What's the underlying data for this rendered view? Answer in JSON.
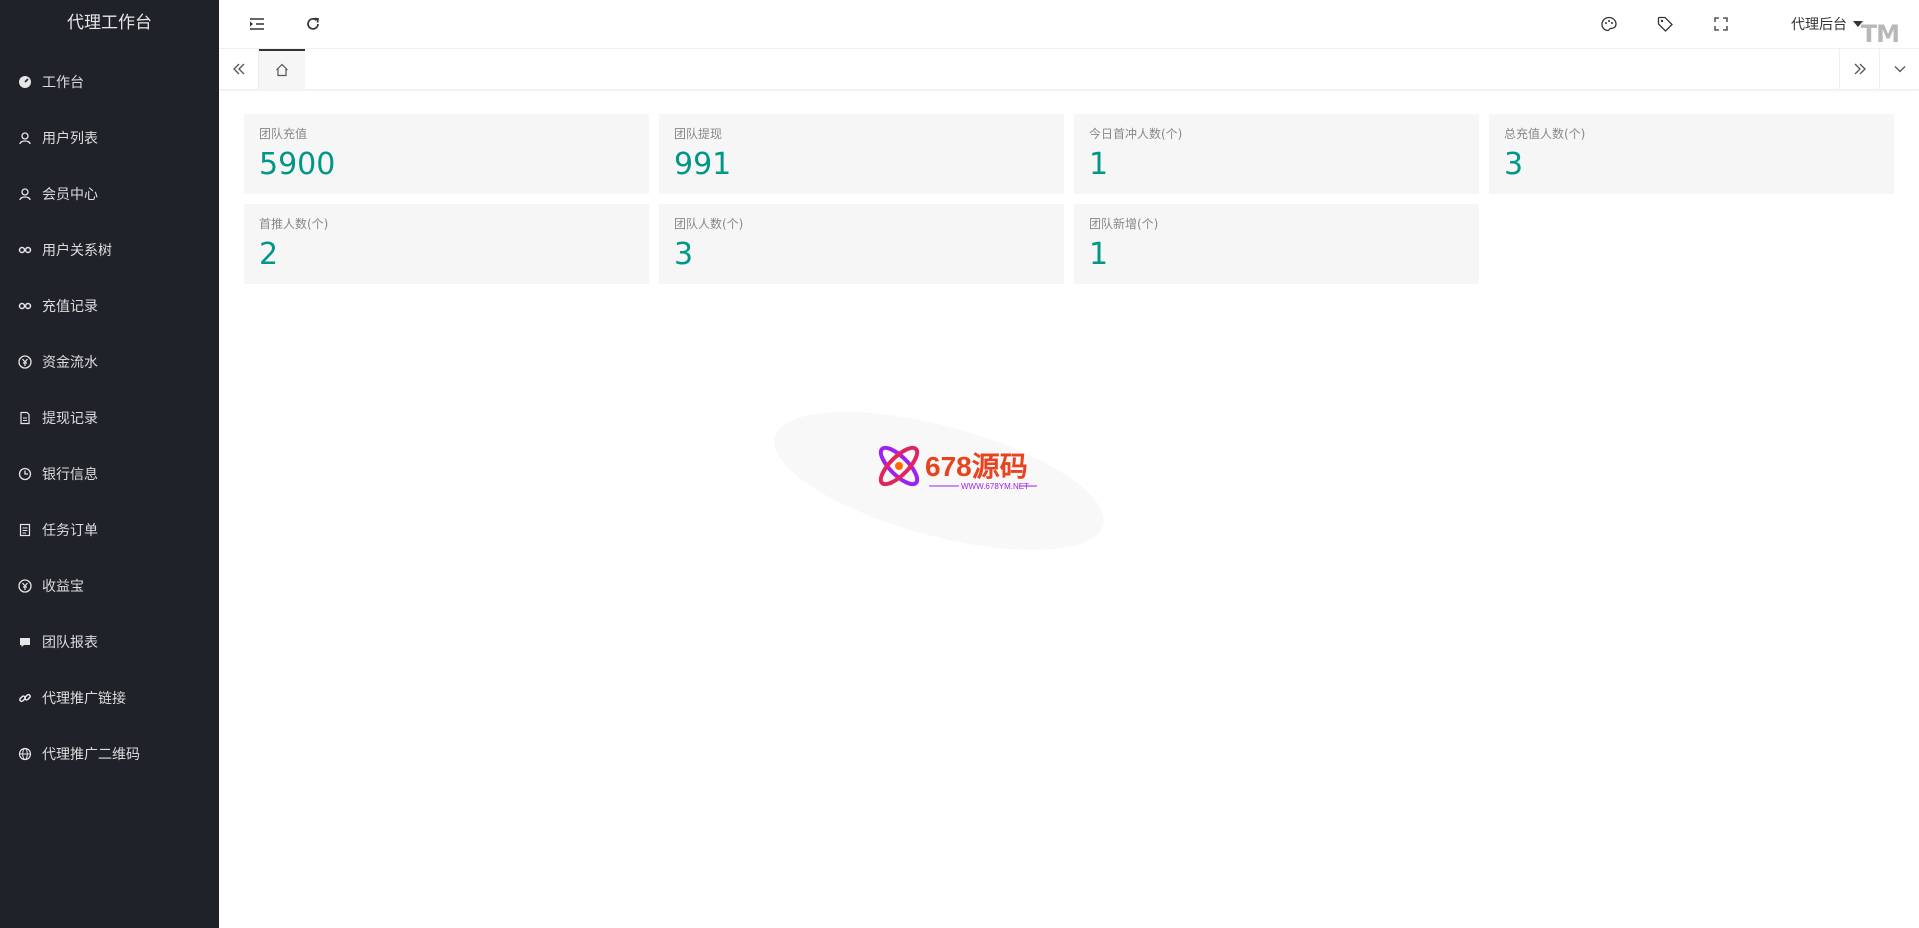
{
  "sidebar": {
    "title": "代理工作台",
    "items": [
      {
        "label": "工作台",
        "icon": "dashboard-icon"
      },
      {
        "label": "用户列表",
        "icon": "user-icon"
      },
      {
        "label": "会员中心",
        "icon": "user-icon"
      },
      {
        "label": "用户关系树",
        "icon": "link-icon"
      },
      {
        "label": "充值记录",
        "icon": "link-icon"
      },
      {
        "label": "资金流水",
        "icon": "rmb-icon"
      },
      {
        "label": "提现记录",
        "icon": "file-icon"
      },
      {
        "label": "银行信息",
        "icon": "clock-icon"
      },
      {
        "label": "任务订单",
        "icon": "list-icon"
      },
      {
        "label": "收益宝",
        "icon": "rmb-icon"
      },
      {
        "label": "团队报表",
        "icon": "chat-icon"
      },
      {
        "label": "代理推广链接",
        "icon": "chain-icon"
      },
      {
        "label": "代理推广二维码",
        "icon": "globe-icon"
      }
    ]
  },
  "header": {
    "user_label": "代理后台",
    "tm": "TM"
  },
  "stats": [
    {
      "label": "团队充值",
      "value": "5900"
    },
    {
      "label": "团队提现",
      "value": "991"
    },
    {
      "label": "今日首冲人数(个)",
      "value": "1"
    },
    {
      "label": "总充值人数(个)",
      "value": "3"
    },
    {
      "label": "首推人数(个)",
      "value": "2"
    },
    {
      "label": "团队人数(个)",
      "value": "3"
    },
    {
      "label": "团队新增(个)",
      "value": "1"
    }
  ],
  "watermark": {
    "brand": "678源码",
    "url": "WWW.678YM.NET"
  },
  "colors": {
    "sidebar_bg": "#20222a",
    "accent": "#009688",
    "card_bg": "#f6f6f6"
  }
}
